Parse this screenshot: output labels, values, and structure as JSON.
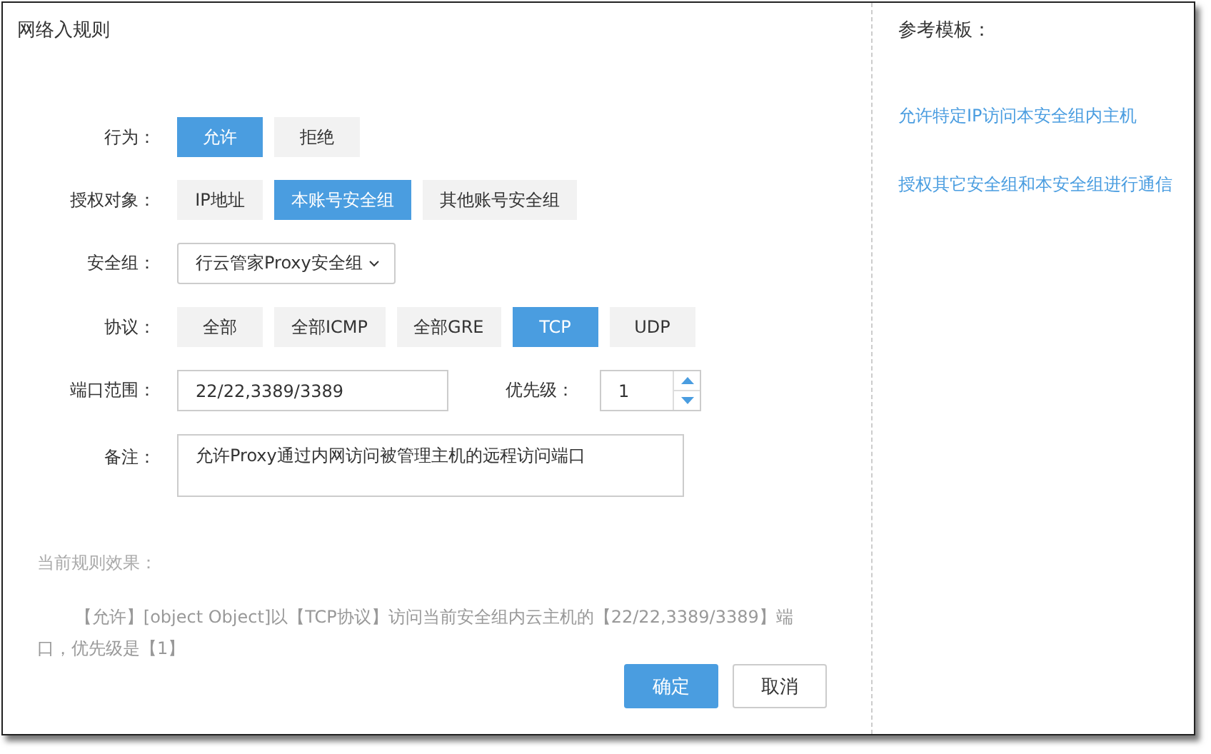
{
  "dialog": {
    "title": "网络入规则"
  },
  "form": {
    "action": {
      "label": "行为：",
      "options": [
        {
          "label": "允许",
          "selected": true
        },
        {
          "label": "拒绝",
          "selected": false
        }
      ]
    },
    "target": {
      "label": "授权对象：",
      "options": [
        {
          "label": "IP地址",
          "selected": false
        },
        {
          "label": "本账号安全组",
          "selected": true
        },
        {
          "label": "其他账号安全组",
          "selected": false
        }
      ]
    },
    "security_group": {
      "label": "安全组：",
      "value": "行云管家Proxy安全组"
    },
    "protocol": {
      "label": "协议：",
      "options": [
        {
          "label": "全部",
          "selected": false
        },
        {
          "label": "全部ICMP",
          "selected": false
        },
        {
          "label": "全部GRE",
          "selected": false
        },
        {
          "label": "TCP",
          "selected": true
        },
        {
          "label": "UDP",
          "selected": false
        }
      ]
    },
    "port_range": {
      "label": "端口范围：",
      "value": "22/22,3389/3389"
    },
    "priority": {
      "label": "优先级：",
      "value": "1"
    },
    "remarks": {
      "label": "备注：",
      "value": "允许Proxy通过内网访问被管理主机的远程访问端口"
    }
  },
  "effect": {
    "label": "当前规则效果：",
    "text": "【允许】[object Object]以【TCP协议】访问当前安全组内云主机的【22/22,3389/3389】端口，优先级是【1】"
  },
  "buttons": [
    {
      "label": "确定",
      "kind": "primary"
    },
    {
      "label": "取消",
      "kind": "default"
    }
  ],
  "templates": {
    "title": "参考模板：",
    "links": [
      "允许特定IP访问本安全组内主机",
      "授权其它安全组和本安全组进行通信"
    ]
  }
}
